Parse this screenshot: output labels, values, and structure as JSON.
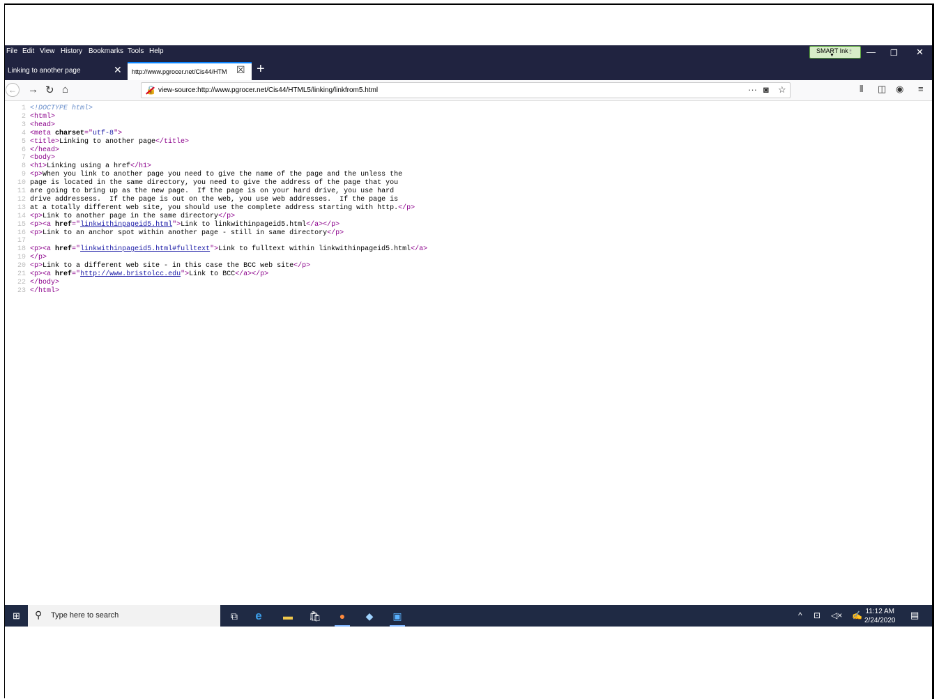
{
  "menubar": {
    "items": [
      "File",
      "Edit",
      "View",
      "History",
      "Bookmarks",
      "Tools",
      "Help"
    ],
    "smart_ink": "SMART Ink"
  },
  "tabs": [
    {
      "title": "Linking to another page",
      "active": false
    },
    {
      "title": "http://www.pgrocer.net/Cis44/HTM",
      "active": true
    }
  ],
  "url": "view-source:http://www.pgrocer.net/Cis44/HTML5/linking/linkfrom5.html",
  "source_lines": [
    "<!DOCTYPE html>",
    "<html>",
    "<head>",
    "<meta charset=\"utf-8\">",
    "<title>Linking to another page</title>",
    "</head>",
    "<body>",
    "<h1>Linking using a href</h1>",
    "<p>When you link to another page you need to give the name of the page and the unless the",
    "page is located in the same directory, you need to give the address of the page that you",
    "are going to bring up as the new page.  If the page is on your hard drive, you use hard",
    "drive addressess.  If the page is out on the web, you use web addresses.  If the page is",
    "at a totally different web site, you should use the complete address starting with http.</p>",
    "<p>Link to another page in the same directory</p>",
    "<p><a href=\"linkwithinpageid5.html\">Link to linkwithinpageid5.html</a></p>",
    "<p>Link to an anchor spot within another page - still in same directory</p>",
    "",
    "<p><a href=\"linkwithinpageid5.html#fulltext\">Link to fulltext within linkwithinpageid5.html</a>",
    "</p>",
    "<p>Link to a different web site - in this case the BCC web site</p>",
    "<p><a href=\"http://www.bristolcc.edu\">Link to BCC</a></p>",
    "</body>",
    "</html>"
  ],
  "taskbar": {
    "search_placeholder": "Type here to search",
    "time": "11:12 AM",
    "date": "2/24/2020"
  },
  "colors": {
    "menubar_bg": "#202340",
    "taskbar_bg": "#1f2a44",
    "tag_color": "#8b008b",
    "link_color": "#1a1aa6",
    "active_tab_accent": "#0a84ff"
  }
}
